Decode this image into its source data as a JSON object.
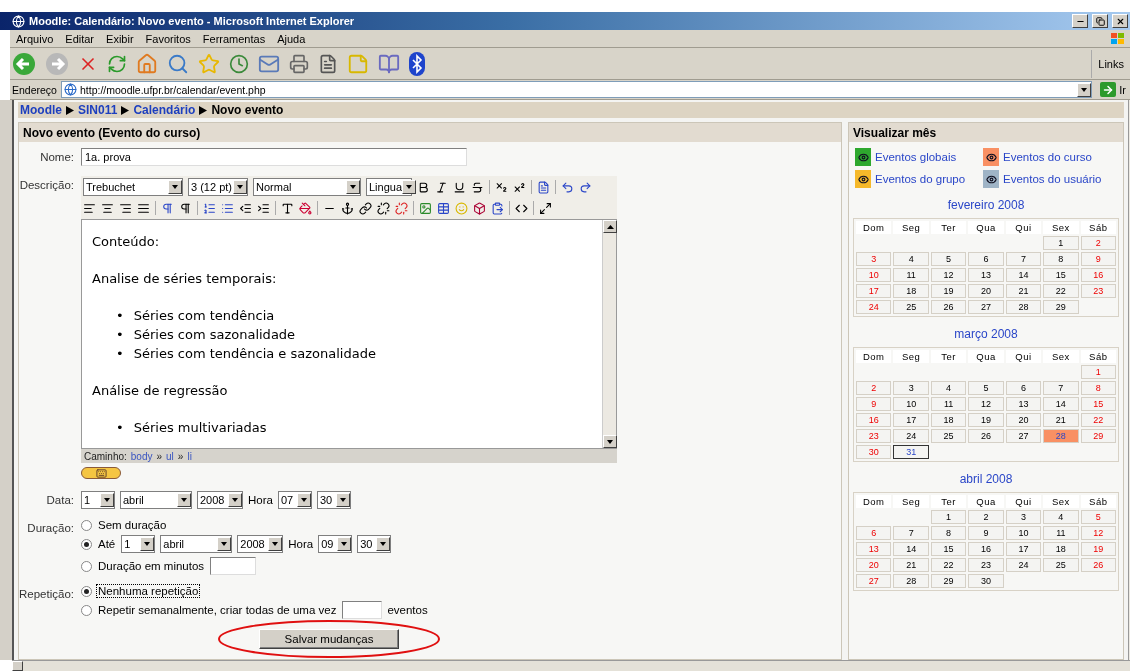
{
  "window": {
    "title": "Moodle: Calendário: Novo evento - Microsoft Internet Explorer"
  },
  "menu": [
    "Arquivo",
    "Editar",
    "Exibir",
    "Favoritos",
    "Ferramentas",
    "Ajuda"
  ],
  "toolbar": {
    "links": "Links"
  },
  "address": {
    "label": "Endereço",
    "value": "http://moodle.ufpr.br/calendar/event.php",
    "go": "Ir"
  },
  "breadcrumb": [
    {
      "label": "Moodle",
      "link": true
    },
    {
      "label": "SIN011",
      "link": true
    },
    {
      "label": "Calendário",
      "link": true
    },
    {
      "label": "Novo evento",
      "link": false
    }
  ],
  "form": {
    "heading": "Novo evento (Evento do curso)",
    "name": {
      "label": "Nome:",
      "value": "1a. prova"
    },
    "description": {
      "label": "Descrição:",
      "font": "Trebuchet",
      "size": "3 (12 pt)",
      "format": "Normal",
      "language": "Lingua",
      "content": [
        {
          "kind": "p",
          "text": "Conteúdo:"
        },
        {
          "kind": "p",
          "text": "Analise de séries temporais:"
        },
        {
          "kind": "ul",
          "bullet": "•",
          "items": [
            "Séries com tendência",
            "Séries com sazonalidade",
            "Séries com tendência e sazonalidade"
          ]
        },
        {
          "kind": "p",
          "text": "Análise de regressão"
        },
        {
          "kind": "ul",
          "bullet": "•",
          "items": [
            "Séries multivariadas"
          ]
        }
      ],
      "path_label": "Caminho:",
      "path": [
        "body",
        "ul",
        "li"
      ],
      "path_separator": "»"
    },
    "date": {
      "label": "Data:",
      "day": "1",
      "month": "abril",
      "year": "2008",
      "hour_label": "Hora",
      "hour": "07",
      "minute": "30"
    },
    "duration": {
      "label": "Duração:",
      "options": [
        {
          "kind": "text",
          "label": "Sem duração",
          "selected": false
        },
        {
          "kind": "until",
          "label": "Até",
          "selected": true,
          "day": "1",
          "month": "abril",
          "year": "2008",
          "hour_label": "Hora",
          "hour": "09",
          "minute": "30"
        },
        {
          "kind": "minutes",
          "label": "Duração em minutos",
          "selected": false
        }
      ]
    },
    "repeat": {
      "label": "Repetição:",
      "options": [
        {
          "kind": "text",
          "label": "Nenhuma repetição",
          "selected": true,
          "focused": true
        },
        {
          "kind": "count",
          "label": "Repetir semanalmente, criar todas de uma vez",
          "suffix": "eventos",
          "selected": false,
          "focused": false
        }
      ]
    },
    "submit": "Salvar mudanças"
  },
  "calendar_panel": {
    "title": "Visualizar mês",
    "legend": [
      {
        "label": "Eventos globais",
        "color": "#2ea82e"
      },
      {
        "label": "Eventos do curso",
        "color": "#f99063"
      },
      {
        "label": "Eventos do grupo",
        "color": "#f5b82a"
      },
      {
        "label": "Eventos do usuário",
        "color": "#9fb4c6"
      }
    ],
    "months": [
      {
        "title": "fevereiro 2008",
        "weekdays": [
          "Dom",
          "Seg",
          "Ter",
          "Qua",
          "Qui",
          "Sex",
          "Sáb"
        ],
        "weeks": [
          [
            {
              "kind": "blank"
            },
            {
              "kind": "blank"
            },
            {
              "kind": "blank"
            },
            {
              "kind": "blank"
            },
            {
              "kind": "blank"
            },
            {
              "kind": "day",
              "day": "1"
            },
            {
              "kind": "day",
              "day": "2"
            }
          ],
          [
            {
              "kind": "day",
              "day": "3"
            },
            {
              "kind": "day",
              "day": "4"
            },
            {
              "kind": "day",
              "day": "5"
            },
            {
              "kind": "day",
              "day": "6"
            },
            {
              "kind": "day",
              "day": "7"
            },
            {
              "kind": "day",
              "day": "8"
            },
            {
              "kind": "day",
              "day": "9"
            }
          ],
          [
            {
              "kind": "day",
              "day": "10"
            },
            {
              "kind": "day",
              "day": "11"
            },
            {
              "kind": "day",
              "day": "12"
            },
            {
              "kind": "day",
              "day": "13"
            },
            {
              "kind": "day",
              "day": "14"
            },
            {
              "kind": "day",
              "day": "15"
            },
            {
              "kind": "day",
              "day": "16"
            }
          ],
          [
            {
              "kind": "day",
              "day": "17"
            },
            {
              "kind": "day",
              "day": "18"
            },
            {
              "kind": "day",
              "day": "19"
            },
            {
              "kind": "day",
              "day": "20"
            },
            {
              "kind": "day",
              "day": "21"
            },
            {
              "kind": "day",
              "day": "22"
            },
            {
              "kind": "day",
              "day": "23"
            }
          ],
          [
            {
              "kind": "day",
              "day": "24"
            },
            {
              "kind": "day",
              "day": "25"
            },
            {
              "kind": "day",
              "day": "26"
            },
            {
              "kind": "day",
              "day": "27"
            },
            {
              "kind": "day",
              "day": "28"
            },
            {
              "kind": "day",
              "day": "29"
            }
          ]
        ]
      },
      {
        "title": "março 2008",
        "weekdays": [
          "Dom",
          "Seg",
          "Ter",
          "Qua",
          "Qui",
          "Sex",
          "Sáb"
        ],
        "weeks": [
          [
            {
              "kind": "blank"
            },
            {
              "kind": "blank"
            },
            {
              "kind": "blank"
            },
            {
              "kind": "blank"
            },
            {
              "kind": "blank"
            },
            {
              "kind": "blank"
            },
            {
              "kind": "day",
              "day": "1"
            }
          ],
          [
            {
              "kind": "day",
              "day": "2"
            },
            {
              "kind": "day",
              "day": "3"
            },
            {
              "kind": "day",
              "day": "4"
            },
            {
              "kind": "day",
              "day": "5"
            },
            {
              "kind": "day",
              "day": "6"
            },
            {
              "kind": "day",
              "day": "7"
            },
            {
              "kind": "day",
              "day": "8"
            }
          ],
          [
            {
              "kind": "day",
              "day": "9"
            },
            {
              "kind": "day",
              "day": "10"
            },
            {
              "kind": "day",
              "day": "11"
            },
            {
              "kind": "day",
              "day": "12"
            },
            {
              "kind": "day",
              "day": "13"
            },
            {
              "kind": "day",
              "day": "14"
            },
            {
              "kind": "day",
              "day": "15"
            }
          ],
          [
            {
              "kind": "day",
              "day": "16"
            },
            {
              "kind": "day",
              "day": "17"
            },
            {
              "kind": "day",
              "day": "18"
            },
            {
              "kind": "day",
              "day": "19"
            },
            {
              "kind": "day",
              "day": "20"
            },
            {
              "kind": "day",
              "day": "21"
            },
            {
              "kind": "day",
              "day": "22"
            }
          ],
          [
            {
              "kind": "day",
              "day": "23"
            },
            {
              "kind": "day",
              "day": "24"
            },
            {
              "kind": "day",
              "day": "25"
            },
            {
              "kind": "day",
              "day": "26"
            },
            {
              "kind": "day",
              "day": "27"
            },
            {
              "kind": "event",
              "day": "28"
            },
            {
              "kind": "day",
              "day": "29"
            }
          ],
          [
            {
              "kind": "day",
              "day": "30"
            },
            {
              "kind": "today",
              "day": "31"
            }
          ]
        ]
      },
      {
        "title": "abril 2008",
        "weekdays": [
          "Dom",
          "Seg",
          "Ter",
          "Qua",
          "Qui",
          "Sex",
          "Sáb"
        ],
        "weeks": [
          [
            {
              "kind": "blank"
            },
            {
              "kind": "blank"
            },
            {
              "kind": "day",
              "day": "1"
            },
            {
              "kind": "day",
              "day": "2"
            },
            {
              "kind": "day",
              "day": "3"
            },
            {
              "kind": "day",
              "day": "4"
            },
            {
              "kind": "day",
              "day": "5"
            }
          ],
          [
            {
              "kind": "day",
              "day": "6"
            },
            {
              "kind": "day",
              "day": "7"
            },
            {
              "kind": "day",
              "day": "8"
            },
            {
              "kind": "day",
              "day": "9"
            },
            {
              "kind": "day",
              "day": "10"
            },
            {
              "kind": "day",
              "day": "11"
            },
            {
              "kind": "day",
              "day": "12"
            }
          ],
          [
            {
              "kind": "day",
              "day": "13"
            },
            {
              "kind": "day",
              "day": "14"
            },
            {
              "kind": "day",
              "day": "15"
            },
            {
              "kind": "day",
              "day": "16"
            },
            {
              "kind": "day",
              "day": "17"
            },
            {
              "kind": "day",
              "day": "18"
            },
            {
              "kind": "day",
              "day": "19"
            }
          ],
          [
            {
              "kind": "day",
              "day": "20"
            },
            {
              "kind": "day",
              "day": "21"
            },
            {
              "kind": "day",
              "day": "22"
            },
            {
              "kind": "day",
              "day": "23"
            },
            {
              "kind": "day",
              "day": "24"
            },
            {
              "kind": "day",
              "day": "25"
            },
            {
              "kind": "day",
              "day": "26"
            }
          ],
          [
            {
              "kind": "day",
              "day": "27"
            },
            {
              "kind": "day",
              "day": "28"
            },
            {
              "kind": "day",
              "day": "29"
            },
            {
              "kind": "day",
              "day": "30"
            }
          ]
        ]
      }
    ]
  }
}
